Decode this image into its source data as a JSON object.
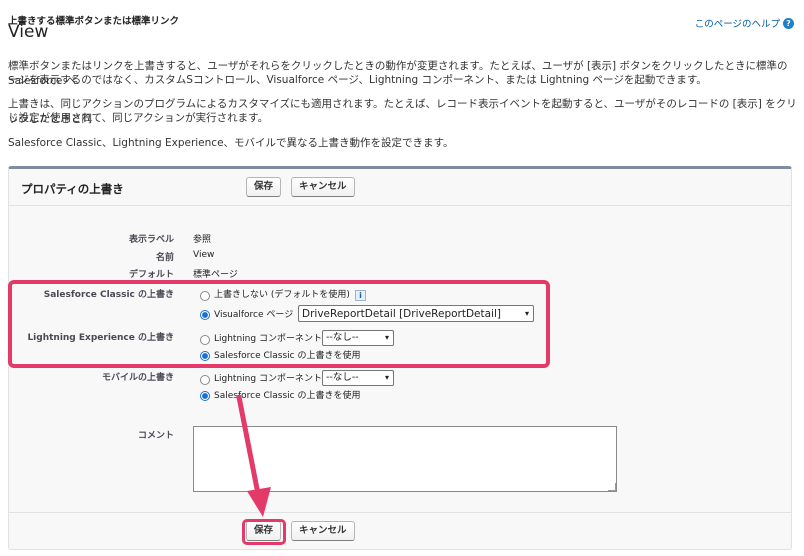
{
  "header": {
    "subtitle": "上書きする標準ボタンまたは標準リンク",
    "title": "View",
    "help_link": "このページのヘルプ"
  },
  "description": [
    "標準ボタンまたはリンクを上書きすると、ユーザがそれらをクリックしたときの動作が変更されます。たとえば、ユーザが [表示] ボタンをクリックしたときに標準の Salesforce ペ",
    "ージを表示するのではなく、カスタムSコントロール、Visualforce ページ、Lightning コンポーネント、または Lightning ページを起動できます。",
    "上書きは、同じアクションのプログラムによるカスタマイズにも適用されます。たとえば、レコード表示イベントを起動すると、ユーザがそのレコードの [表示] をクリックしたときと同",
    "じ設定が使用されて、同じアクションが実行されます。",
    "Salesforce Classic、Lightning Experience、モバイルで異なる上書き動作を設定できます。"
  ],
  "panel": {
    "title": "プロパティの上書き",
    "save_label": "保存",
    "cancel_label": "キャンセル"
  },
  "fields": {
    "display_label": {
      "label": "表示ラベル",
      "value": "参照"
    },
    "name": {
      "label": "名前",
      "value": "View"
    },
    "default": {
      "label": "デフォルト",
      "value": "標準ページ"
    }
  },
  "classic": {
    "label": "Salesforce Classic の上書き",
    "option_none": "上書きしない (デフォルトを使用)",
    "option_vf": "Visualforce ページ",
    "vf_selected": "DriveReportDetail [DriveReportDetail]"
  },
  "lightning": {
    "label": "Lightning Experience の上書き",
    "option_component": "Lightning コンポーネント",
    "component_selected": "--なし--",
    "option_classic": "Salesforce Classic の上書きを使用"
  },
  "mobile": {
    "label": "モバイルの上書き",
    "option_component": "Lightning コンポーネント",
    "component_selected": "--なし--",
    "option_classic": "Salesforce Classic の上書きを使用"
  },
  "comment": {
    "label": "コメント",
    "value": ""
  },
  "icons": {
    "info": "i",
    "help": "?",
    "chevron": "▾"
  },
  "colors": {
    "highlight": "#e43a6a",
    "radio_selected": "#1a6fd3",
    "link": "#015ba7"
  }
}
